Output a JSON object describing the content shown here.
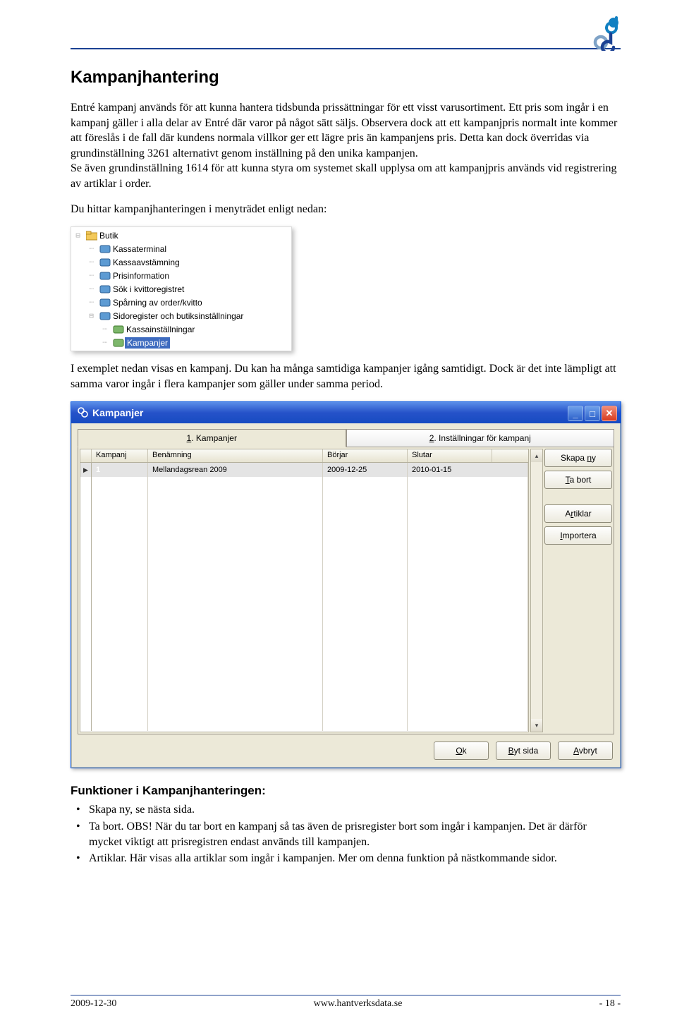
{
  "heading": "Kampanjhantering",
  "para1": "Entré kampanj används för att kunna hantera tidsbunda prissättningar för ett visst varusortiment. Ett pris som ingår i en kampanj gäller i alla delar av Entré där varor på något sätt säljs. Observera dock att ett kampanjpris normalt inte kommer att föreslås i de fall där kundens normala villkor ger ett lägre pris än kampanjens pris. Detta kan dock överridas via grundinställning 3261 alternativt genom inställning på den unika kampanjen.",
  "para1b": "Se även grundinställning 1614 för att kunna styra om systemet skall upplysa om att kampanjpris används vid registrering av artiklar i order.",
  "para2": "Du hittar kampanjhanteringen i menyträdet enligt nedan:",
  "tree": {
    "root": "Butik",
    "items": [
      "Kassaterminal",
      "Kassaavstämning",
      "Prisinformation",
      "Sök i kvittoregistret",
      "Spårning av order/kvitto"
    ],
    "sub_label": "Sidoregister och butiksinställningar",
    "sub_items": [
      "Kassainställningar",
      "Kampanjer"
    ]
  },
  "para3": "I exemplet nedan visas en kampanj. Du kan ha många samtidiga kampanjer igång samtidigt. Dock är det inte lämpligt att samma varor ingår i flera kampanjer som gäller under samma period.",
  "dialog": {
    "title": "Kampanjer",
    "tab1": {
      "num": "1",
      "label": ". Kampanjer"
    },
    "tab2": {
      "num": "2",
      "label": ". Inställningar för kampanj"
    },
    "headers": {
      "h1": "Kampanj",
      "h2": "Benämning",
      "h3": "Börjar",
      "h4": "Slutar"
    },
    "row": {
      "id": "1",
      "name": "Mellandagsrean 2009",
      "start": "2009-12-25",
      "end": "2010-01-15"
    },
    "buttons": {
      "new": "Skapa ny",
      "delete": "Ta bort",
      "articles": "Artiklar",
      "import": "Importera",
      "ok": "Ok",
      "switch": "Byt sida",
      "cancel": "Avbryt"
    }
  },
  "sub_heading": "Funktioner i Kampanjhanteringen:",
  "bullets": [
    "Skapa ny, se nästa sida.",
    "Ta bort. OBS! När du tar bort en kampanj så tas även de prisregister bort som ingår i kampanjen. Det är därför mycket viktigt att prisregistren endast används till kampanjen.",
    "Artiklar. Här visas alla artiklar som ingår i kampanjen. Mer om denna funktion på nästkommande sidor."
  ],
  "footer": {
    "date": "2009-12-30",
    "url": "www.hantverksdata.se",
    "page": "- 18 -"
  }
}
